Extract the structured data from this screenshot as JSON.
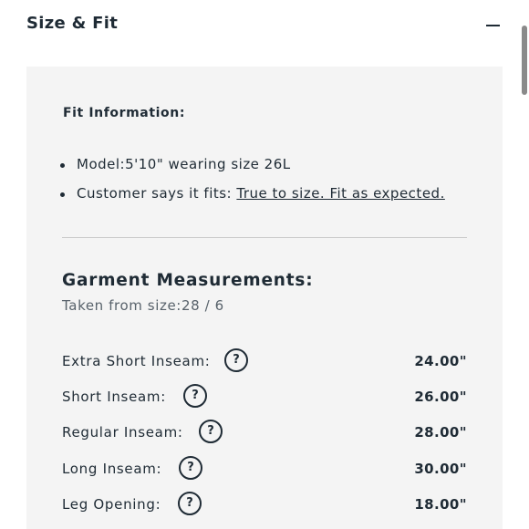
{
  "section": {
    "title": "Size & Fit",
    "collapse_icon": "minus-icon"
  },
  "fit_information": {
    "heading": "Fit Information:",
    "model_text": "Model:5'10\" wearing size 26L",
    "customer_prefix": "Customer says it fits: ",
    "customer_link": "True to size. Fit as expected."
  },
  "garment_measurements": {
    "heading": "Garment Measurements:",
    "subheading": "Taken from size:28 / 6",
    "help_glyph": "?",
    "rows": [
      {
        "label": "Extra Short Inseam:",
        "value": "24.00\""
      },
      {
        "label": "Short Inseam:",
        "value": "26.00\""
      },
      {
        "label": "Regular Inseam:",
        "value": "28.00\""
      },
      {
        "label": "Long Inseam:",
        "value": "30.00\""
      },
      {
        "label": "Leg Opening:",
        "value": "18.00\""
      }
    ]
  },
  "colors": {
    "text": "#1f2b35",
    "panel_background": "#f4f4f4",
    "divider": "#c9c9c9"
  }
}
